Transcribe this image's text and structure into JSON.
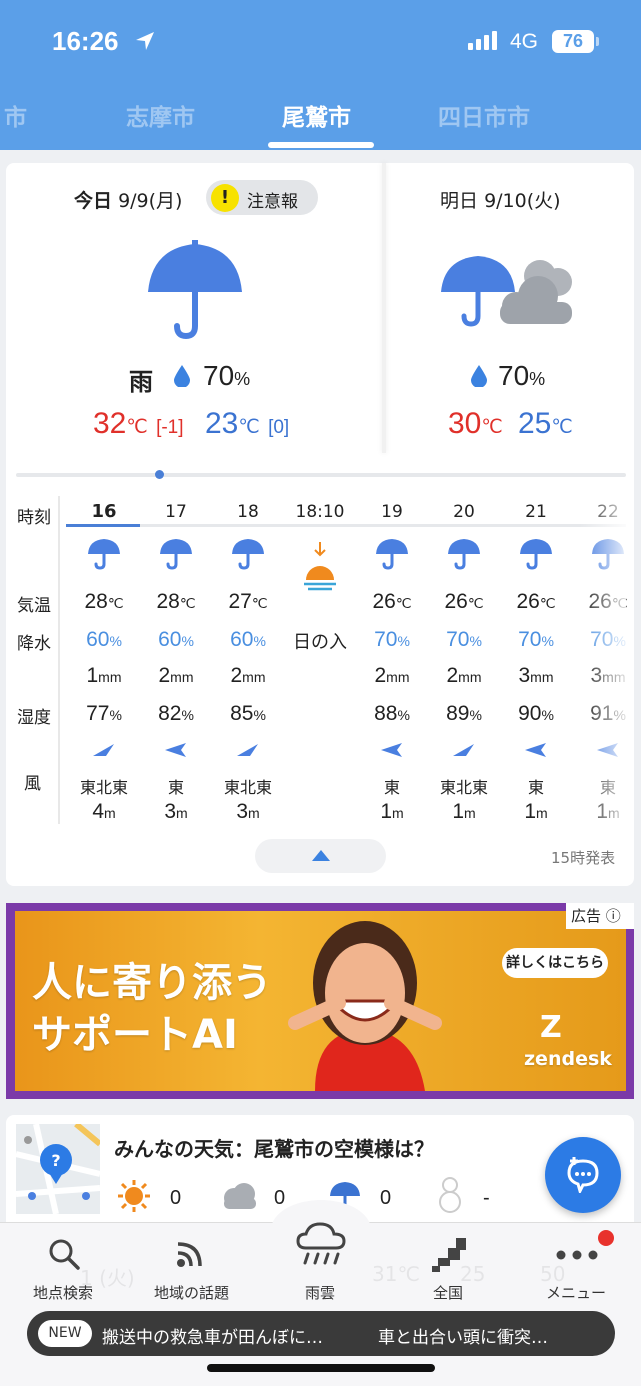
{
  "status_bar": {
    "time": "16:26",
    "network": "4G",
    "battery": "76"
  },
  "city_tabs": [
    {
      "label": "市"
    },
    {
      "label": "志摩市"
    },
    {
      "label": "尾鷲市"
    },
    {
      "label": "四日市市"
    }
  ],
  "today": {
    "label": "今日",
    "date": "9/9",
    "weekday": "(月)",
    "alert": "注意報",
    "condition": "雨",
    "precip": "70",
    "precip_unit": "%",
    "high": "32",
    "high_diff": "[-1]",
    "low": "23",
    "low_diff": "[0]",
    "temp_unit": "℃"
  },
  "tomorrow": {
    "label": "明日",
    "date": "9/10",
    "weekday": "(火)",
    "precip": "70",
    "precip_unit": "%",
    "high": "30",
    "low": "25",
    "temp_unit": "℃"
  },
  "hourly_labels": {
    "time": "時刻",
    "temp": "気温",
    "precip": "降水",
    "humidity": "湿度",
    "wind": "風"
  },
  "hourly": [
    {
      "hour": "16",
      "temp": "28",
      "precip": "60",
      "rain": "1",
      "humidity": "77",
      "wind_dir": "東北東",
      "wind_speed": "4"
    },
    {
      "hour": "17",
      "temp": "28",
      "precip": "60",
      "rain": "2",
      "humidity": "82",
      "wind_dir": "東",
      "wind_speed": "3"
    },
    {
      "hour": "18",
      "temp": "27",
      "precip": "60",
      "rain": "2",
      "humidity": "85",
      "wind_dir": "東北東",
      "wind_speed": "3"
    },
    {
      "hour": "18:10",
      "sunset_label": "日の入"
    },
    {
      "hour": "19",
      "temp": "26",
      "precip": "70",
      "rain": "2",
      "humidity": "88",
      "wind_dir": "東",
      "wind_speed": "1"
    },
    {
      "hour": "20",
      "temp": "26",
      "precip": "70",
      "rain": "2",
      "humidity": "89",
      "wind_dir": "東北東",
      "wind_speed": "1"
    },
    {
      "hour": "21",
      "temp": "26",
      "precip": "70",
      "rain": "3",
      "humidity": "90",
      "wind_dir": "東",
      "wind_speed": "1"
    },
    {
      "hour": "22",
      "temp": "26",
      "precip": "70",
      "rain": "3",
      "humidity": "91",
      "wind_dir": "東",
      "wind_speed": "1"
    }
  ],
  "units": {
    "temp": "℃",
    "precip": "%",
    "rain": "mm",
    "humidity": "%",
    "wind": "m"
  },
  "published": "15時発表",
  "ad": {
    "label": "広告",
    "headline1": "人に寄り添う",
    "headline2": "サポートAI",
    "button": "詳しくはこちら",
    "brand": "zendesk"
  },
  "minna": {
    "title": "みんなの天気：尾鷲市の空模様は？",
    "counts": [
      "0",
      "0",
      "0",
      "-"
    ]
  },
  "bottom_nav": [
    {
      "label": "地点検索"
    },
    {
      "label": "地域の話題"
    },
    {
      "label": "雨雲"
    },
    {
      "label": "全国"
    },
    {
      "label": "メニュー"
    }
  ],
  "nav_ghost": [
    "1 (火)",
    "31℃",
    "25",
    "50"
  ],
  "ticker": {
    "badge": "NEW",
    "item1": "搬送中の救急車が田んぼに…",
    "item2": "車と出合い頭に衝突…"
  },
  "colors": {
    "header": "#5b9fe8",
    "umbrella": "#4a7fe0",
    "high": "#e0302a",
    "low": "#3b73d1",
    "fab": "#2c7be5",
    "ad_frame": "#7b3aa8"
  }
}
